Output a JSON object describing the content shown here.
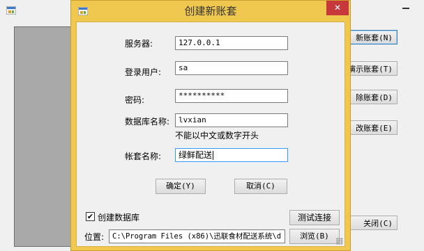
{
  "background_window": {
    "buttons": [
      {
        "label": "新账套(N)"
      },
      {
        "label": "演示账套(T)"
      },
      {
        "label": "除账套(D)"
      },
      {
        "label": "改账套(E)"
      },
      {
        "label": "关闭(C)"
      }
    ]
  },
  "dialog": {
    "title": "创建新账套",
    "close_glyph": "✕",
    "server": {
      "label": "服务器:",
      "value": "127.0.0.1"
    },
    "login_user": {
      "label": "登录用户:",
      "value": "sa"
    },
    "password": {
      "label": "密码:",
      "value": "**********"
    },
    "database_name": {
      "label": "数据库名称:",
      "value": "lvxian",
      "hint": "不能以中文或数字开头"
    },
    "account_name": {
      "label": "帐套名称:",
      "value": "绿鲜配送"
    },
    "ok_button": "确定(Y)",
    "cancel_button": "取消(C)",
    "create_db_checkbox": {
      "label": "创建数据库",
      "checked": true,
      "check_glyph": "✔"
    },
    "test_connection_button": "测试连接",
    "location": {
      "label": "位置:",
      "value": "C:\\Program Files (x86)\\迅联食材配送系统\\d"
    },
    "browse_button": "浏览(B)"
  },
  "colors": {
    "dialog_frame": "#f0c850",
    "close_button": "#c7383b",
    "focus_border": "#3399ff"
  }
}
